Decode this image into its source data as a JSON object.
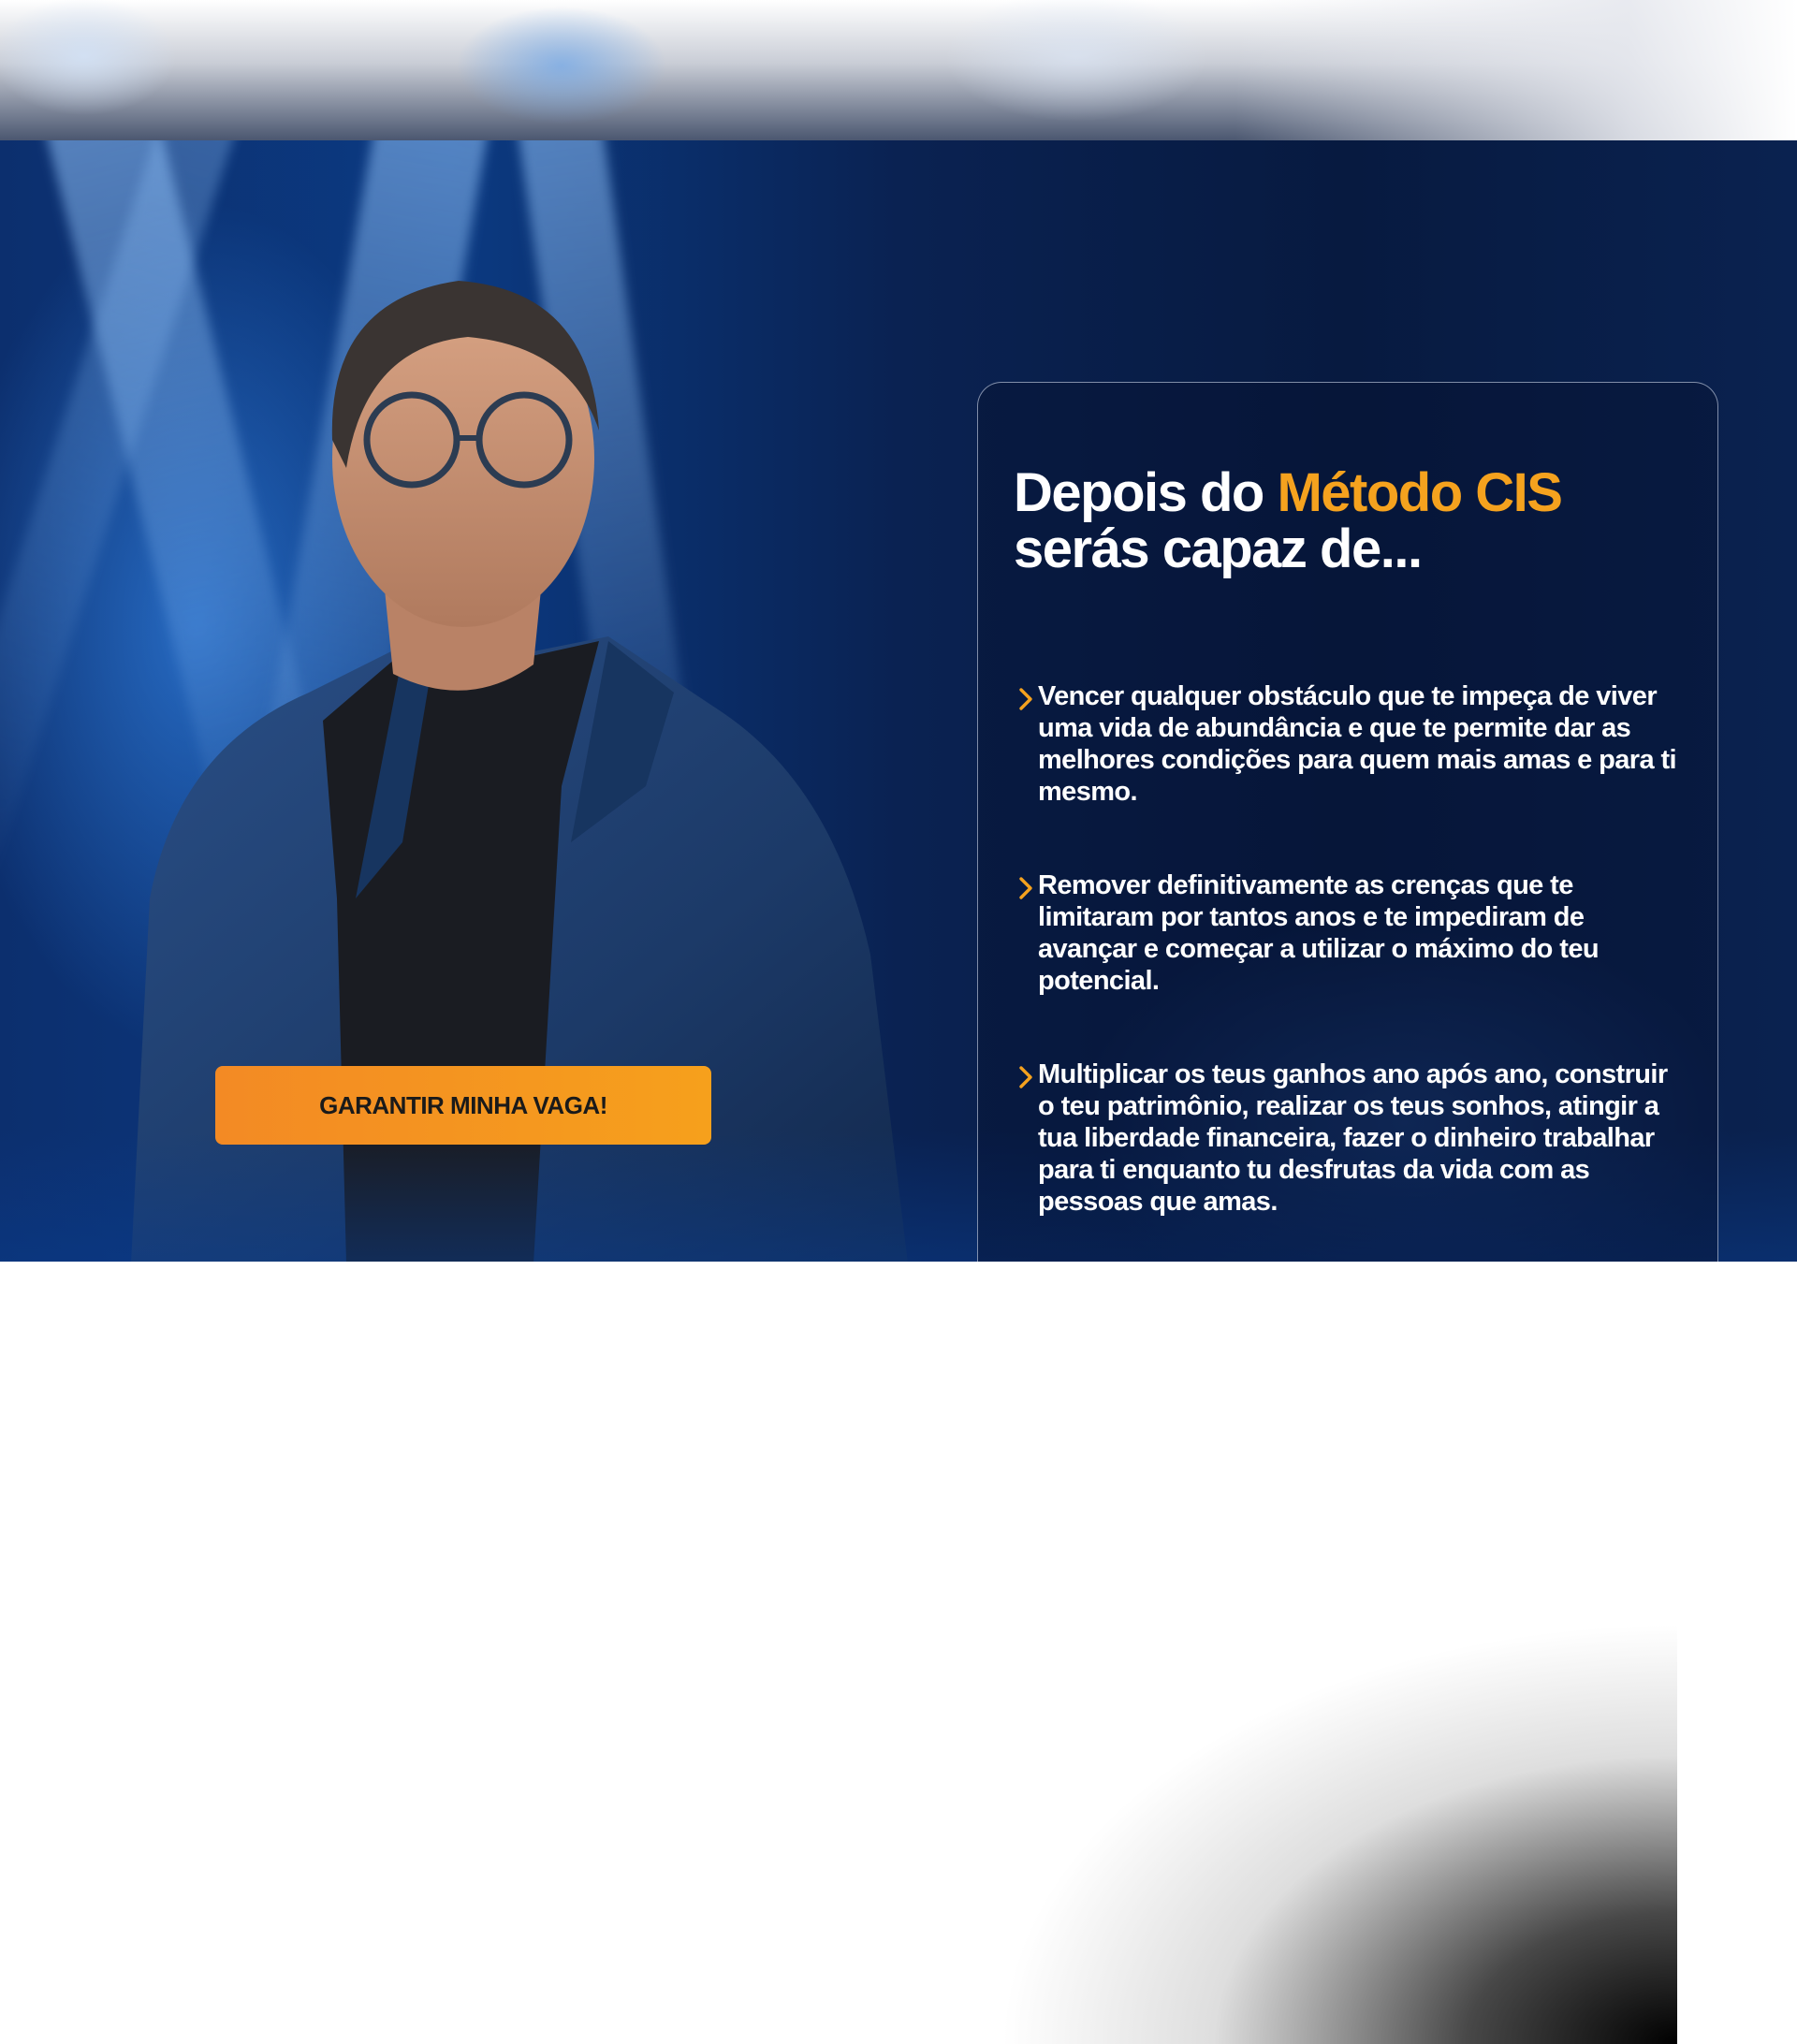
{
  "hero": {
    "cta_label": "GARANTIR MINHA VAGA!"
  },
  "card": {
    "title_part1": "Depois do ",
    "title_accent": "Método CIS",
    "title_part2": "serás capaz de...",
    "items": [
      {
        "text": "Vencer qualquer obstáculo que te impeça de viver uma vida de abundância e que te permite dar as melhores condições para quem mais amas e para ti mesmo."
      },
      {
        "text": "Remover definitivamente as crenças que te limitaram por tantos anos e te impediram de avançar e começar a utilizar o máximo do teu potencial."
      },
      {
        "text": "Multiplicar os teus ganhos ano após ano, construir o teu patrimônio, realizar os teus sonhos, atingir a tua liberdade financeira, fazer o dinheiro trabalhar para ti enquanto tu desfrutas da vida com as pessoas que amas."
      }
    ]
  },
  "colors": {
    "accent": "#f5a21e",
    "cta_start": "#f38a24",
    "cta_end": "#f6a01c",
    "hero_bg": "#0a2252",
    "text": "#ffffff"
  },
  "icons": {
    "bullet": "chevron-right-icon"
  }
}
